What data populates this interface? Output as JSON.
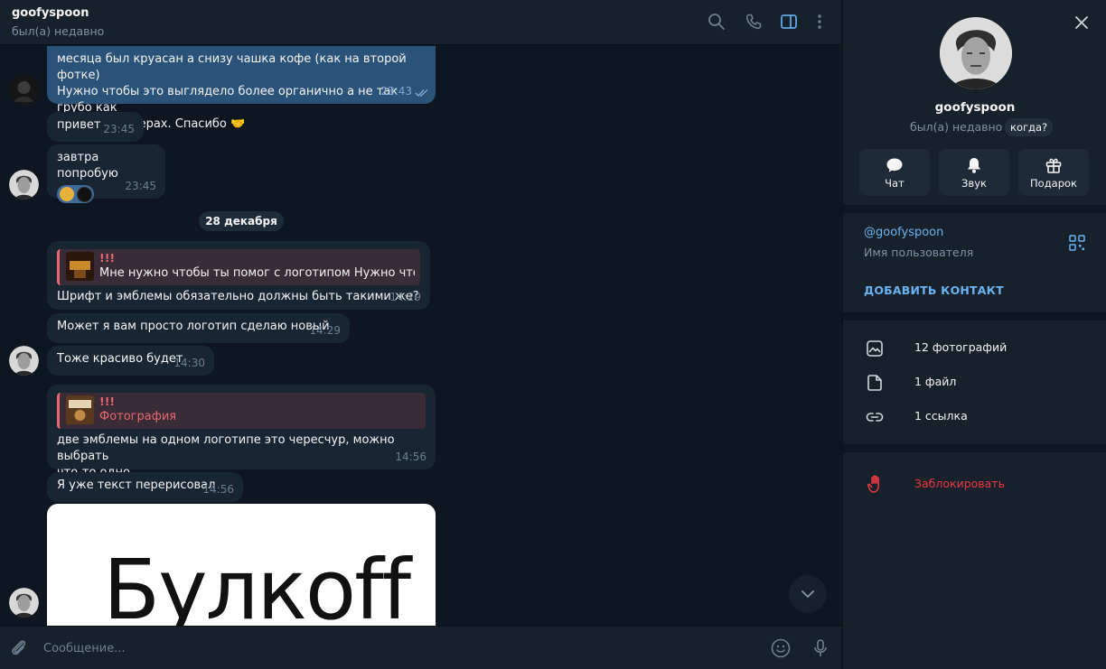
{
  "header": {
    "title": "goofyspoon",
    "status": "был(а) недавно",
    "icons": [
      "search-icon",
      "phone-icon",
      "sidebar-toggle-icon",
      "more-vertical-icon"
    ]
  },
  "messages": {
    "m1_lines": [
      "месяца был круасан а снизу чашка кофе (как на второй фотке)",
      "Нужно чтобы это выглядело более органично а не так грубо как",
      "на этих примерах. Спасибо 🤝"
    ],
    "m1_time": "23:43",
    "m2_text": "привет",
    "m2_time": "23:45",
    "m3_text": "завтра попробую",
    "m3_time": "23:45",
    "date_separator": "28 декабря",
    "m4_reply_title": "!!!",
    "m4_reply_text": "Мне нужно чтобы ты помог с логотипом   Нужно чтоб...",
    "m4_text": "Шрифт и эмблемы обязательно должны быть такими же?",
    "m4_time": "14:29",
    "m5_text": "Может я вам просто логотип сделаю новый",
    "m5_time": "14:29",
    "m6_text": "Тоже красиво будет",
    "m6_time": "14:30",
    "m7_reply_title": "!!!",
    "m7_reply_text": "Фотография",
    "m7_line1": "две эмблемы на одном логотипе это чересчур, можно выбрать",
    "m7_line2": "что-то одно",
    "m7_time": "14:56",
    "m8_text": "Я уже текст перерисовал",
    "m8_time": "14:56",
    "photo_logo_text": "Булкoff"
  },
  "composer": {
    "placeholder": "Сообщение..."
  },
  "profile": {
    "name": "goofyspoon",
    "status": "был(а) недавно",
    "when_badge": "когда?",
    "actions": [
      {
        "label": "Чат",
        "icon": "chat-icon"
      },
      {
        "label": "Звук",
        "icon": "bell-icon"
      },
      {
        "label": "Подарок",
        "icon": "gift-icon"
      }
    ],
    "username": "@goofyspoon",
    "username_label": "Имя пользователя",
    "add_contact": "ДОБАВИТЬ КОНТАКТ",
    "media": [
      {
        "label": "12 фотографий",
        "icon": "photo-icon"
      },
      {
        "label": "1 файл",
        "icon": "file-icon"
      },
      {
        "label": "1 ссылка",
        "icon": "link-icon"
      }
    ],
    "block": "Заблокировать"
  },
  "colors": {
    "chat_bg": "#0e1621",
    "panel_bg": "#17212b",
    "incoming_bubble": "#182533",
    "outgoing_bubble": "#2b5278",
    "accent": "#6ab3f3",
    "danger": "#ec3942",
    "reply_accent": "#e86770"
  }
}
